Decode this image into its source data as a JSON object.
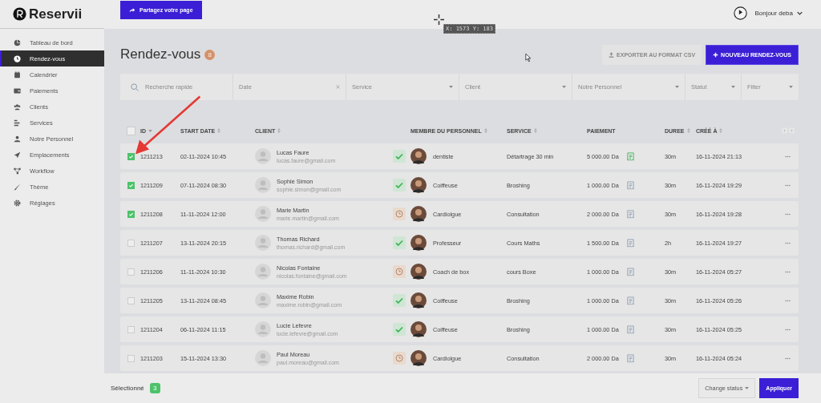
{
  "sidebar": {
    "logo": "Reservii",
    "items": [
      {
        "label": "Tableau de bord",
        "selected": false
      },
      {
        "label": "Rendez-vous",
        "selected": true
      },
      {
        "label": "Calendrier",
        "selected": false
      },
      {
        "label": "Paiements",
        "selected": false
      },
      {
        "label": "Clients",
        "selected": false
      },
      {
        "label": "Services",
        "selected": false
      },
      {
        "label": "Notre Personnel",
        "selected": false
      },
      {
        "label": "Emplacements",
        "selected": false
      },
      {
        "label": "Workflow",
        "selected": false
      },
      {
        "label": "Thème",
        "selected": false
      },
      {
        "label": "Réglages",
        "selected": false
      }
    ]
  },
  "header": {
    "share_button": "Partagez votre page",
    "greeting": "Bonjour deba",
    "cursor_readout": "X: 1573 Y: 183"
  },
  "page": {
    "title": "Rendez-vous",
    "count": "8",
    "export_button": "EXPORTER AU FORMAT CSV",
    "new_button": "NOUVEAU RENDEZ-VOUS"
  },
  "filters": [
    {
      "kind": "search",
      "placeholder": "Recherche rapide"
    },
    {
      "kind": "date",
      "placeholder": "Date"
    },
    {
      "kind": "select",
      "placeholder": "Service"
    },
    {
      "kind": "select",
      "placeholder": "Client"
    },
    {
      "kind": "select",
      "placeholder": "Notre Personnel"
    },
    {
      "kind": "select",
      "placeholder": "Statut"
    },
    {
      "kind": "select",
      "placeholder": "Filter"
    }
  ],
  "table": {
    "select_all": {
      "checked": false
    },
    "columns": [
      {
        "label": "ID",
        "sorted": true
      },
      {
        "label": "START DATE",
        "sortable": true
      },
      {
        "label": "CLIENT",
        "sortable": true
      },
      {
        "label": "MEMBRE DU PERSONNEL",
        "sortable": true
      },
      {
        "label": "SERVICE",
        "sortable": true
      },
      {
        "label": "PAIEMENT",
        "sortable": false
      },
      {
        "label": "DUREE",
        "sortable": true
      },
      {
        "label": "CRÉÉ À",
        "sortable": true
      }
    ],
    "rows": [
      {
        "checked": true,
        "id": "1211213",
        "start": "02-11-2024 10:45",
        "client": "Lucas Faure",
        "email": "lucas.faure@gmail.com",
        "confirmed": true,
        "staff": "dentiste",
        "service": "Détartrage 30 min",
        "payment": "5 000.00 Da",
        "paid": true,
        "duration": "30m",
        "created": "16-11-2024 21:13"
      },
      {
        "checked": true,
        "id": "1211209",
        "start": "07-11-2024 08:30",
        "client": "Sophie Simon",
        "email": "sophie.simon@gmail.com",
        "confirmed": true,
        "staff": "Coiffeuse",
        "service": "Broshing",
        "payment": "1 000.00 Da",
        "paid": false,
        "duration": "30m",
        "created": "16-11-2024 19:29"
      },
      {
        "checked": true,
        "id": "1211208",
        "start": "11-11-2024 12:00",
        "client": "Marie Martin",
        "email": "marie.martin@gmail.com",
        "confirmed": false,
        "staff": "Cardiolgue",
        "service": "Consultation",
        "payment": "2 000.00 Da",
        "paid": false,
        "duration": "30m",
        "created": "16-11-2024 19:28"
      },
      {
        "checked": false,
        "id": "1211207",
        "start": "13-11-2024 20:15",
        "client": "Thomas Richard",
        "email": "thomas.richard@gmail.com",
        "confirmed": true,
        "staff": "Professeur",
        "service": "Cours Maths",
        "payment": "1 500.00 Da",
        "paid": false,
        "duration": "2h",
        "created": "16-11-2024 19:27"
      },
      {
        "checked": false,
        "id": "1211206",
        "start": "11-11-2024 10:30",
        "client": "Nicolas Fontaine",
        "email": "nicolas.fontaine@gmail.com",
        "confirmed": false,
        "staff": "Coach de box",
        "service": "cours Boxe",
        "payment": "1 000.00 Da",
        "paid": false,
        "duration": "30m",
        "created": "16-11-2024 05:27"
      },
      {
        "checked": false,
        "id": "1211205",
        "start": "13-11-2024 08:45",
        "client": "Maxime Robin",
        "email": "maxime.robin@gmail.com",
        "confirmed": true,
        "staff": "Coiffeuse",
        "service": "Broshing",
        "payment": "1 000.00 Da",
        "paid": false,
        "duration": "30m",
        "created": "16-11-2024 05:26"
      },
      {
        "checked": false,
        "id": "1211204",
        "start": "06-11-2024 11:15",
        "client": "Lucie Lefevre",
        "email": "lucie.lefevre@gmail.com",
        "confirmed": true,
        "staff": "Coiffeuse",
        "service": "Broshing",
        "payment": "1 000.00 Da",
        "paid": false,
        "duration": "30m",
        "created": "16-11-2024 05:25"
      },
      {
        "checked": false,
        "id": "1211203",
        "start": "15-11-2024 13:30",
        "client": "Paul Moreau",
        "email": "paul.moreau@gmail.com",
        "confirmed": false,
        "staff": "Cardiolgue",
        "service": "Consultation",
        "payment": "2 000.00 Da",
        "paid": false,
        "duration": "30m",
        "created": "16-11-2024 05:24"
      }
    ]
  },
  "footer": {
    "label": "Sélectionné",
    "count": "3",
    "status_select": "Change status",
    "apply_button": "Appliquer"
  }
}
